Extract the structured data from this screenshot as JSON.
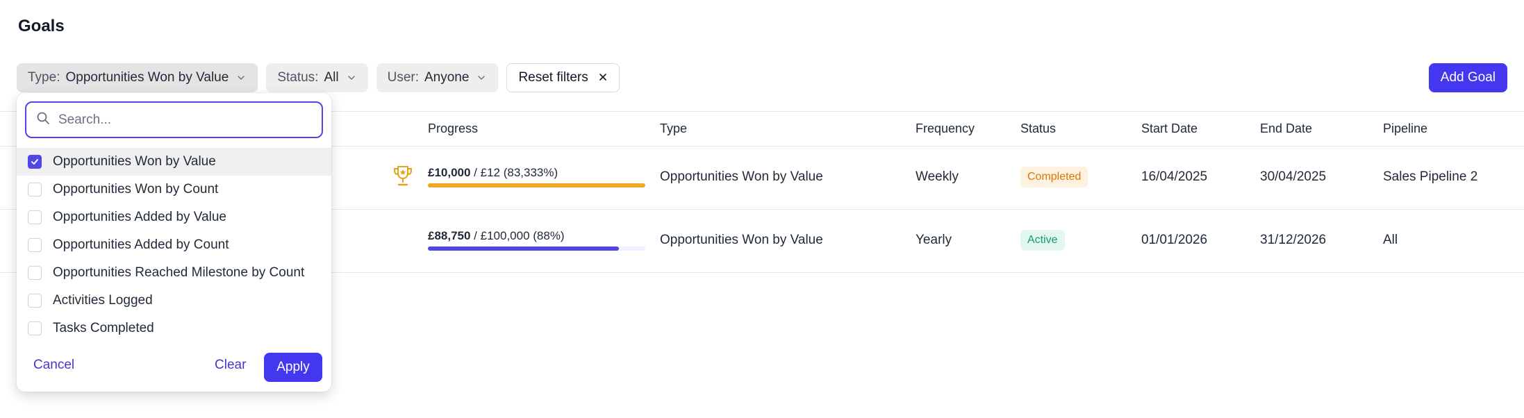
{
  "page": {
    "title": "Goals"
  },
  "filters": {
    "type": {
      "label": "Type:",
      "value": "Opportunities Won by Value"
    },
    "status": {
      "label": "Status:",
      "value": "All"
    },
    "user": {
      "label": "User:",
      "value": "Anyone"
    },
    "reset_label": "Reset filters"
  },
  "actions": {
    "add_goal": "Add Goal"
  },
  "dropdown": {
    "search_placeholder": "Search...",
    "options": [
      {
        "label": "Opportunities Won by Value",
        "checked": true
      },
      {
        "label": "Opportunities Won by Count",
        "checked": false
      },
      {
        "label": "Opportunities Added by Value",
        "checked": false
      },
      {
        "label": "Opportunities Added by Count",
        "checked": false
      },
      {
        "label": "Opportunities Reached Milestone by Count",
        "checked": false
      },
      {
        "label": "Activities Logged",
        "checked": false
      },
      {
        "label": "Tasks Completed",
        "checked": false
      }
    ],
    "cancel": "Cancel",
    "clear": "Clear",
    "apply": "Apply"
  },
  "table": {
    "columns": {
      "progress": "Progress",
      "type": "Type",
      "frequency": "Frequency",
      "status": "Status",
      "start_date": "Start Date",
      "end_date": "End Date",
      "pipeline": "Pipeline"
    },
    "rows": [
      {
        "progress_current": "£10,000",
        "progress_rest": " / £12 (83,333%)",
        "progress_fraction": 1.0,
        "type": "Opportunities Won by Value",
        "frequency": "Weekly",
        "status": "Completed",
        "start_date": "16/04/2025",
        "end_date": "30/04/2025",
        "pipeline": "Sales Pipeline 2"
      },
      {
        "progress_current": "£88,750",
        "progress_rest": " / £100,000 (88%)",
        "progress_fraction": 0.88,
        "type": "Opportunities Won by Value",
        "frequency": "Yearly",
        "status": "Active",
        "start_date": "01/01/2026",
        "end_date": "31/12/2026",
        "pipeline": "All"
      }
    ]
  },
  "colors": {
    "accent": "#4338f0",
    "completed_bar": "#f5a623",
    "active_bar": "#4f46e5",
    "active_bar_track": "#eef0ff",
    "trophy": "#e5a21a"
  }
}
